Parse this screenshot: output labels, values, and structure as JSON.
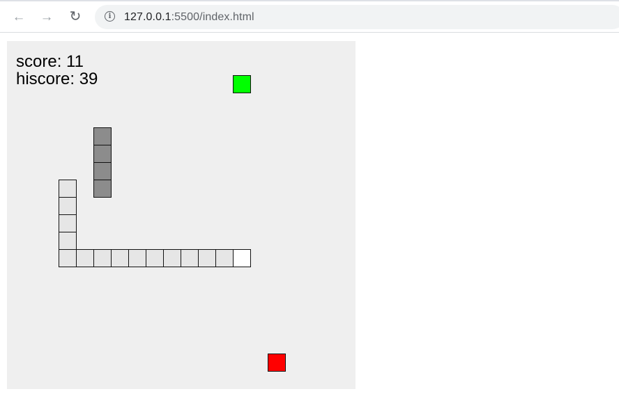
{
  "browser": {
    "url_host": "127.0.0.1",
    "url_rest": ":5500/index.html",
    "icons": [
      "back-arrow-icon",
      "forward-arrow-icon",
      "reload-icon",
      "info-icon"
    ]
  },
  "hud": {
    "score_label": "score: 11",
    "hiscore_label": "hiscore: 39"
  },
  "colors": {
    "board": "#efefef",
    "snake_body": "#e6e6e6",
    "snake_head": "#ffffff",
    "obstacle": "#8c8c8c",
    "food": "#00ff00",
    "hazard": "#ff0000"
  }
}
